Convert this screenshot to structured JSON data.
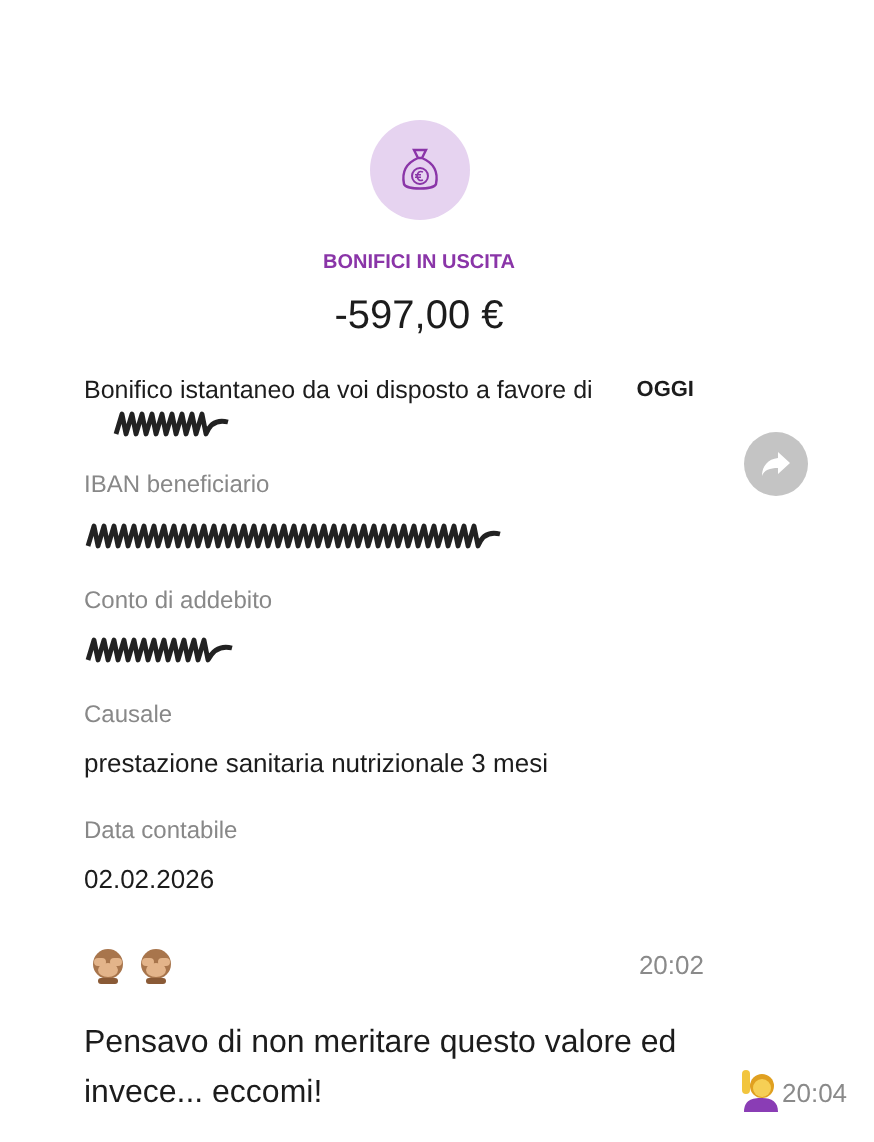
{
  "transfer": {
    "category": "BONIFICI IN USCITA",
    "amount": "-597,00 €",
    "description": "Bonifico istantaneo da voi disposto a favore di",
    "date_badge": "OGGI",
    "fields": [
      {
        "label": "IBAN beneficiario",
        "kind": "redacted"
      },
      {
        "label": "Conto di addebito",
        "kind": "redacted"
      },
      {
        "label": "Causale",
        "kind": "text",
        "value": "prestazione sanitaria nutrizionale 3 mesi"
      },
      {
        "label": "Data contabile",
        "kind": "text",
        "value": "02.02.2026"
      }
    ]
  },
  "messages": [
    {
      "kind": "emoji",
      "time": "20:02"
    },
    {
      "kind": "text",
      "text": "Pensavo di non meritare questo valore ed invece... eccomi!",
      "trailing_emoji": true,
      "time": "20:04"
    }
  ]
}
